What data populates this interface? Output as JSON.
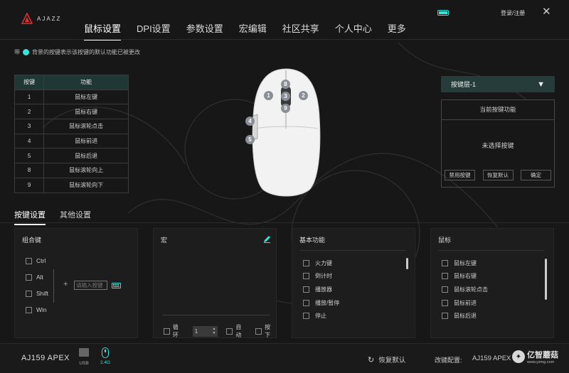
{
  "brand": {
    "name": "AJAZZ"
  },
  "header": {
    "login": "登录/注册",
    "close_icon": "close-icon",
    "battery_icon": "battery-icon"
  },
  "nav": {
    "tabs": [
      "鼠标设置",
      "DPI设置",
      "参数设置",
      "宏编辑",
      "社区共享",
      "个人中心",
      "更多"
    ],
    "active": 0
  },
  "hint": {
    "prefix": "带",
    "text": "背景的按键表示该按键的默认功能已被更改",
    "dot_color": "#34e5d9"
  },
  "key_table": {
    "headers": [
      "按键",
      "功能"
    ],
    "rows": [
      {
        "key": "1",
        "func": "鼠标左键"
      },
      {
        "key": "2",
        "func": "鼠标右键"
      },
      {
        "key": "3",
        "func": "鼠标滚轮点击"
      },
      {
        "key": "4",
        "func": "鼠标前进"
      },
      {
        "key": "5",
        "func": "鼠标后退"
      },
      {
        "key": "8",
        "func": "鼠标滚轮向上"
      },
      {
        "key": "9",
        "func": "鼠标滚轮向下"
      }
    ]
  },
  "mouse_badges": [
    "1",
    "2",
    "3",
    "8",
    "9",
    "4",
    "5"
  ],
  "layer": {
    "selected": "按键层-1",
    "arrow": "▼"
  },
  "current_func": {
    "title": "当前按键功能",
    "empty": "未选择按键",
    "buttons": [
      "禁用按键",
      "恢复默认",
      "确定"
    ]
  },
  "subtabs": {
    "items": [
      "按键设置",
      "其他设置"
    ],
    "active": 0
  },
  "combo": {
    "title": "组合键",
    "keys": [
      "Ctrl",
      "Alt",
      "Shift",
      "Win"
    ],
    "plus": "+",
    "input_placeholder": "请输入按键",
    "keyboard_icon": "keyboard-icon"
  },
  "macro": {
    "title": "宏",
    "edit_icon": "pencil-icon",
    "loop_label": "循环",
    "count": "1",
    "auto_label": "自动",
    "press_label": "按下"
  },
  "basic": {
    "title": "基本功能",
    "items": [
      "火力键",
      "倒计时",
      "播放器",
      "播放/暂停",
      "停止"
    ]
  },
  "mouse_funcs": {
    "title": "鼠标",
    "items": [
      "鼠标左键",
      "鼠标右键",
      "鼠标滚轮点击",
      "鼠标前进",
      "鼠标后退"
    ]
  },
  "footer": {
    "device": "AJ159 APEX",
    "usb": "USB",
    "wireless": "2.4G",
    "restore": "恢复默认",
    "config_label": "改键配置:",
    "config_value": "AJ159 APEX",
    "watermark": "亿智蘑菇",
    "watermark_url": "www.yzmg.com"
  },
  "colors": {
    "accent": "#34e5d9",
    "dropdown_bg": "#253c3a",
    "table_header": "#1f3836"
  }
}
